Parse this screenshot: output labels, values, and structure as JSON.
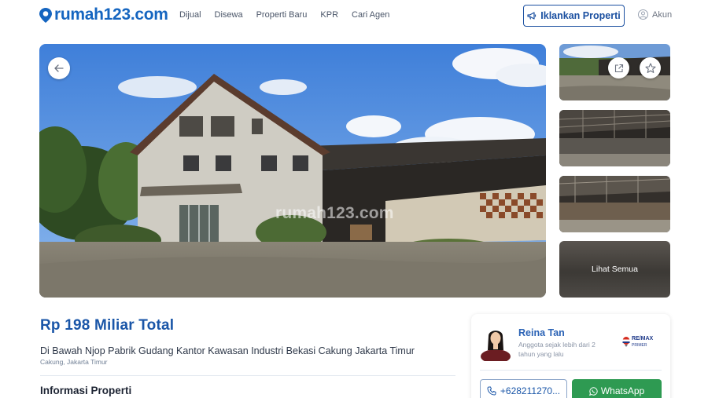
{
  "header": {
    "logo_text": "rumah123.com",
    "nav": [
      "Dijual",
      "Disewa",
      "Properti Baru",
      "KPR",
      "Cari Agen"
    ],
    "iklankan_label": "Iklankan Properti",
    "akun_label": "Akun"
  },
  "gallery": {
    "watermark": "rumah123.com",
    "see_all_label": "Lihat Semua"
  },
  "listing": {
    "price": "Rp 198 Miliar Total",
    "title": "Di Bawah Njop Pabrik Gudang Kantor Kawasan Industri Bekasi Cakung Jakarta Timur",
    "location": "Cakung, Jakarta Timur",
    "section_title": "Informasi Properti"
  },
  "agent": {
    "name": "Reina Tan",
    "member_since": "Anggota sejak lebih dari 2 tahun yang lalu",
    "agency_name": "RE/MAX",
    "agency_sub": "PRIMER",
    "phone": "+628211270...",
    "whatsapp_label": "WhatsApp"
  },
  "colors": {
    "brand": "#1565c0",
    "price": "#1a56a8",
    "whatsapp": "#2e9a52"
  }
}
